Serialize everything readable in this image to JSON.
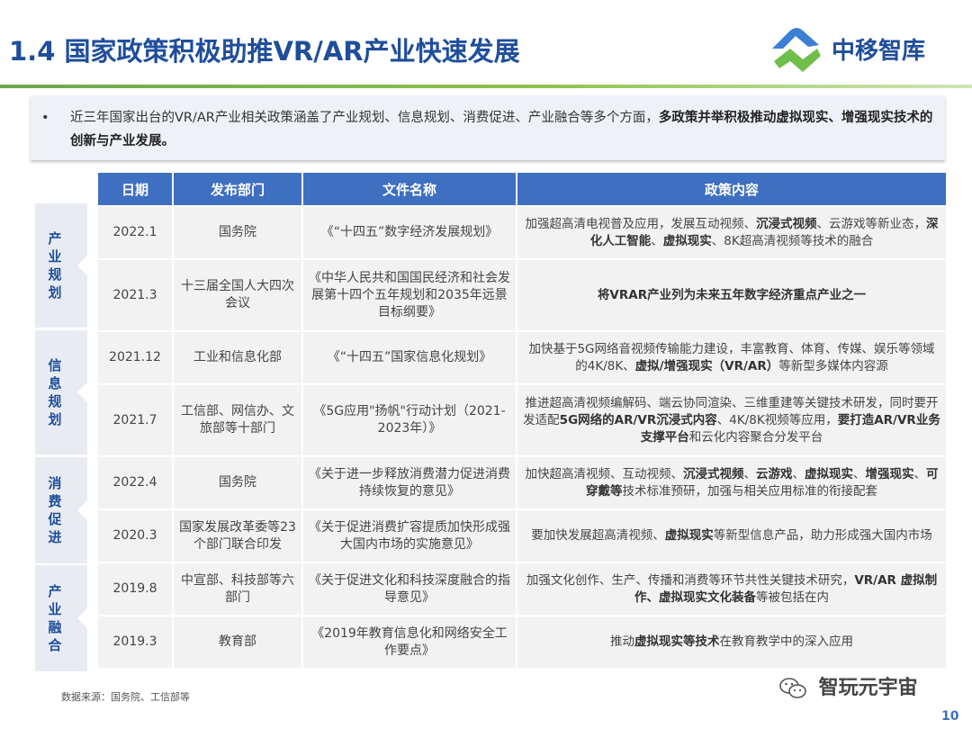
{
  "header": {
    "title": "1.4 国家政策积极助推VR/AR产业快速发展",
    "logo_text": "中移智库"
  },
  "summary": {
    "bullet": "•",
    "text_plain": "近三年国家出台的VR/AR产业相关政策涵盖了产业规划、信息规划、消费促进、产业融合等多个方面，",
    "text_bold": "多政策并举积极推动虚拟现实、增强现实技术的创新与产业发展。"
  },
  "table": {
    "headers": [
      "日期",
      "发布部门",
      "文件名称",
      "政策内容"
    ],
    "categories": [
      "产业规划",
      "信息规划",
      "消费促进",
      "产业融合"
    ],
    "rows": [
      {
        "date": "2022.1",
        "dept": "国务院",
        "doc": "《“十四五”数字经济发展规划》",
        "content": [
          [
            "加强超高清电视普及应用，发展互动视频、",
            false
          ],
          [
            "沉浸式视频",
            true
          ],
          [
            "、云游戏等新业态，",
            false
          ],
          [
            "深化人工智能",
            true
          ],
          [
            "、",
            false
          ],
          [
            "虚拟现实",
            true
          ],
          [
            "、8K超高清视频等技术的融合",
            false
          ]
        ]
      },
      {
        "date": "2021.3",
        "dept": "十三届全国人大四次会议",
        "doc": "《中华人民共和国国民经济和社会发展第十四个五年规划和2035年远景目标纲要》",
        "content": [
          [
            "将VRAR产业列为未来五年数字经济重点产业之一",
            true
          ]
        ]
      },
      {
        "date": "2021.12",
        "dept": "工业和信息化部",
        "doc": "《“十四五”国家信息化规划》",
        "content": [
          [
            "加快基于5G网络音视频传输能力建设，丰富教育、体育、传媒、娱乐等领域的4K/8K、",
            false
          ],
          [
            "虚拟/增强现实（VR/AR）",
            true
          ],
          [
            "等新型多媒体内容源",
            false
          ]
        ]
      },
      {
        "date": "2021.7",
        "dept": "工信部、网信办、文旅部等十部门",
        "doc": "《5G应用\"扬帆\"行动计划（2021-2023年）》",
        "content": [
          [
            "推进超高清视频编解码、端云协同渲染、三维重建等关键技术研发，同时要开发适配",
            false
          ],
          [
            "5G网络的AR/VR沉浸式内容",
            true
          ],
          [
            "、4K/8K视频等应用，",
            false
          ],
          [
            "要打造AR/VR业务支撑平台",
            true
          ],
          [
            "和云化内容聚合分发平台",
            false
          ]
        ]
      },
      {
        "date": "2022.4",
        "dept": "国务院",
        "doc": "《关于进一步释放消费潜力促进消费持续恢复的意见》",
        "content": [
          [
            "加快超高清视频、互动视频、",
            false
          ],
          [
            "沉浸式视频",
            true
          ],
          [
            "、",
            false
          ],
          [
            "云游戏",
            true
          ],
          [
            "、",
            false
          ],
          [
            "虚拟现实",
            true
          ],
          [
            "、",
            false
          ],
          [
            "增强现实",
            true
          ],
          [
            "、",
            false
          ],
          [
            "可穿戴等",
            true
          ],
          [
            "技术标准预研，加强与相关应用标准的衔接配套",
            false
          ]
        ]
      },
      {
        "date": "2020.3",
        "dept": "国家发展改革委等23个部门联合印发",
        "doc": "《关于促进消费扩容提质加快形成强大国内市场的实施意见》",
        "content": [
          [
            "要加快发展超高清视频、",
            false
          ],
          [
            "虚拟现实",
            true
          ],
          [
            "等新型信息产品，助力形成强大国内市场",
            false
          ]
        ]
      },
      {
        "date": "2019.8",
        "dept": "中宣部、科技部等六部门",
        "doc": "《关于促进文化和科技深度融合的指导意见》",
        "content": [
          [
            "加强文化创作、生产、传播和消费等环节共性关键技术研究，",
            false
          ],
          [
            "VR/AR 虚拟制作、虚拟现实文化装备",
            true
          ],
          [
            "等被包括在内",
            false
          ]
        ]
      },
      {
        "date": "2019.3",
        "dept": "教育部",
        "doc": "《2019年教育信息化和网络安全工作要点》",
        "content": [
          [
            "推动",
            false
          ],
          [
            "虚拟现实等技术",
            true
          ],
          [
            "在教育教学中的深入应用",
            false
          ]
        ]
      }
    ]
  },
  "footer": {
    "source": "数据来源：国务院、工信部等",
    "wechat_name": "智玩元宇宙",
    "page_number": "10"
  },
  "colors": {
    "title_blue": "#1f4e9c",
    "header_blue": "#3f6fc1",
    "divider_green": "#6aa84f"
  }
}
